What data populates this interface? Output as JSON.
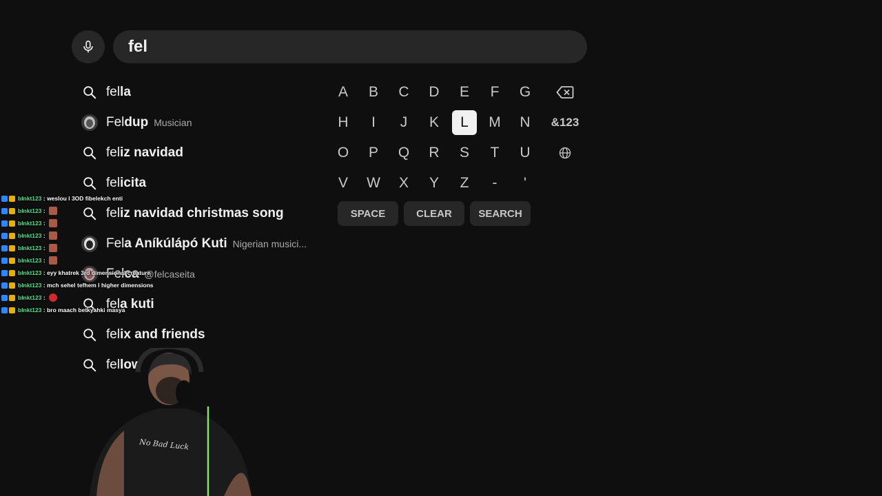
{
  "search": {
    "query": "fel"
  },
  "suggestions": [
    {
      "type": "query",
      "typed": "fel",
      "rest": "la",
      "sub": ""
    },
    {
      "type": "channel",
      "typed": "Fel",
      "rest": "dup",
      "sub": "Musician"
    },
    {
      "type": "query",
      "typed": "fel",
      "rest": "iz navidad",
      "sub": ""
    },
    {
      "type": "query",
      "typed": "fel",
      "rest": "icita",
      "sub": ""
    },
    {
      "type": "query",
      "typed": "fel",
      "rest": "iz navidad christmas song",
      "sub": ""
    },
    {
      "type": "channel",
      "typed": "Fel",
      "rest": "a Aníkúlápó Kuti",
      "sub": "Nigerian musici..."
    },
    {
      "type": "channel",
      "typed": "Fel",
      "rest": "ca",
      "sub": "@felcaseita"
    },
    {
      "type": "query",
      "typed": "fel",
      "rest": "a kuti",
      "sub": ""
    },
    {
      "type": "query",
      "typed": "fel",
      "rest": "ix and friends",
      "sub": ""
    },
    {
      "type": "query",
      "typed": "fel",
      "rest": "low",
      "sub": ""
    }
  ],
  "keyboard": {
    "rows": [
      [
        "A",
        "B",
        "C",
        "D",
        "E",
        "F",
        "G"
      ],
      [
        "H",
        "I",
        "J",
        "K",
        "L",
        "M",
        "N"
      ],
      [
        "O",
        "P",
        "Q",
        "R",
        "S",
        "T",
        "U"
      ],
      [
        "V",
        "W",
        "X",
        "Y",
        "Z",
        "-",
        "'"
      ]
    ],
    "special": {
      "backspace_icon": "backspace-icon",
      "symbols": "&123",
      "language_icon": "globe-icon"
    },
    "active_key": "L",
    "actions": {
      "space": "SPACE",
      "clear": "CLEAR",
      "search": "SEARCH"
    }
  },
  "chat": [
    {
      "user": "blnkt123",
      "msg": "weslou l 3OD fibelekch enti",
      "emote": ""
    },
    {
      "user": "blnkt123",
      "msg": "",
      "emote": "face"
    },
    {
      "user": "blnkt123",
      "msg": "",
      "emote": "face"
    },
    {
      "user": "blnkt123",
      "msg": "",
      "emote": "face"
    },
    {
      "user": "blnkt123",
      "msg": "",
      "emote": "face"
    },
    {
      "user": "blnkt123",
      "msg": "",
      "emote": "face"
    },
    {
      "user": "blnkt123",
      "msg": "eyy khatrek 3rd dimensional creature",
      "emote": ""
    },
    {
      "user": "blnkt123",
      "msg": "mch sehel tefhem l higher dimensions",
      "emote": ""
    },
    {
      "user": "blnkt123",
      "msg": "",
      "emote": "red"
    },
    {
      "user": "blnkt123",
      "msg": "bro maach betkyahki masya",
      "emote": ""
    }
  ],
  "colors": {
    "background": "#0f0f0f",
    "surface": "#272727",
    "text": "#f1f1f1",
    "muted": "#aaaaaa",
    "chat_username": "#59e08d"
  }
}
